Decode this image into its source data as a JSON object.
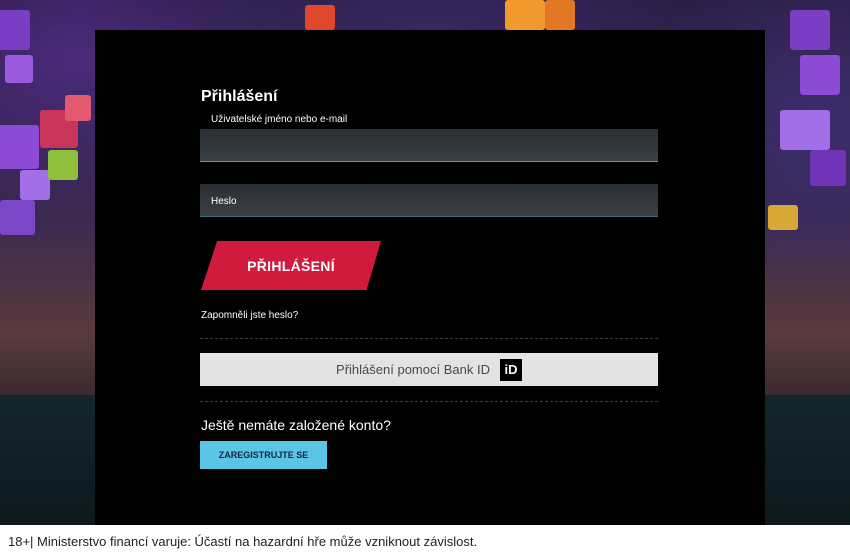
{
  "login": {
    "title": "Přihlášení",
    "username_label": "Uživatelské jméno nebo e-mail",
    "username_value": "",
    "password_placeholder": "Heslo",
    "submit_label": "PŘIHLÁŠENÍ",
    "forgot_password": "Zapomněli jste heslo?",
    "bankid_label": "Přihlášení pomocí Bank ID",
    "bankid_logo": "iD"
  },
  "register": {
    "prompt": "Ještě nemáte založené konto?",
    "button_label": "ZAREGISTRUJTE SE"
  },
  "footer": {
    "warning": "18+| Ministerstvo financí varuje: Účastí na hazardní hře může vzniknout závislost."
  },
  "colors": {
    "accent_red": "#d01a3e",
    "accent_blue": "#5bc5e6",
    "panel": "#000000"
  }
}
